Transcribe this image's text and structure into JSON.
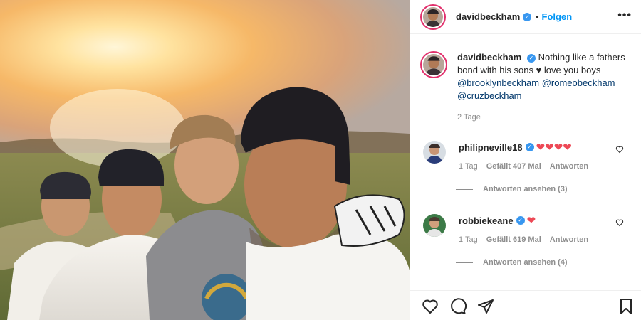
{
  "post": {
    "author": "davidbeckham",
    "follow_label": "Folgen",
    "more_label": "•••",
    "separator": "•",
    "caption_text": "Nothing like a fathers bond with his sons ♥ love you boys",
    "mentions": [
      "@brooklynbeckham",
      "@romeobeckham",
      "@cruzbeckham"
    ],
    "age": "2 Tage"
  },
  "comments": [
    {
      "user": "philipneville18",
      "text": "❤❤❤❤",
      "age": "1 Tag",
      "likes": "Gefällt 407 Mal",
      "reply_label": "Antworten",
      "view_replies": "Antworten ansehen (3)"
    },
    {
      "user": "robbiekeane",
      "text": "❤",
      "age": "1 Tag",
      "likes": "Gefällt 619 Mal",
      "reply_label": "Antworten",
      "view_replies": "Antworten ansehen (4)"
    }
  ],
  "icons": {
    "like": "heart-icon",
    "comment": "comment-icon",
    "share": "share-icon",
    "save": "bookmark-icon",
    "more": "more-icon",
    "verified": "verified-badge-icon"
  },
  "colors": {
    "follow": "#0095f6",
    "heart": "#ed4956",
    "verified": "#3897f0",
    "story_ring": "#e1306c"
  }
}
